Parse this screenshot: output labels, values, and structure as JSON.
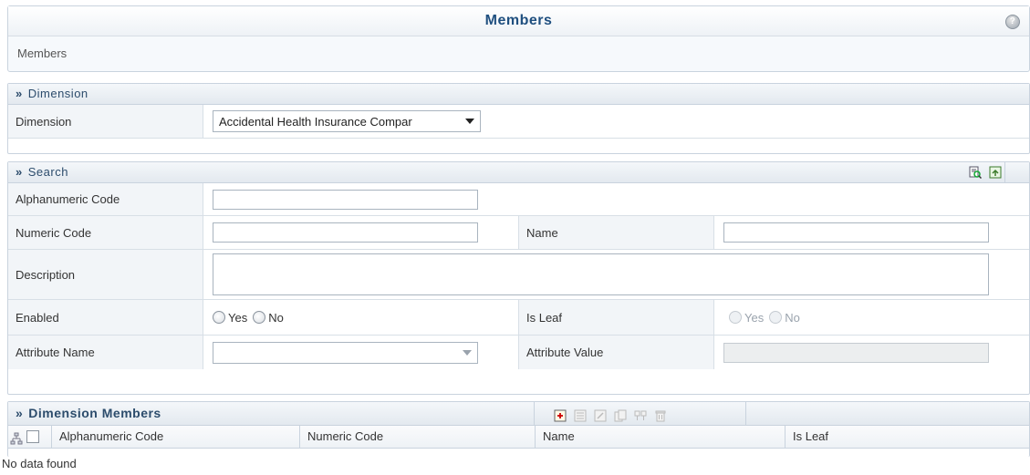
{
  "page": {
    "title": "Members",
    "breadcrumb": "Members",
    "help_icon": "help-icon"
  },
  "dimension_section": {
    "header": "Dimension",
    "label": "Dimension",
    "selected": "Accidental Health Insurance Compar"
  },
  "search_section": {
    "header": "Search",
    "toolbar_icons": [
      "search-icon",
      "reset-icon"
    ],
    "fields": {
      "alphanumeric_code": {
        "label": "Alphanumeric Code",
        "value": ""
      },
      "numeric_code": {
        "label": "Numeric Code",
        "value": ""
      },
      "name": {
        "label": "Name",
        "value": ""
      },
      "description": {
        "label": "Description",
        "value": ""
      },
      "enabled": {
        "label": "Enabled",
        "yes": "Yes",
        "no": "No"
      },
      "is_leaf": {
        "label": "Is Leaf",
        "yes": "Yes",
        "no": "No"
      },
      "attribute_name": {
        "label": "Attribute Name",
        "value": ""
      },
      "attribute_value": {
        "label": "Attribute Value",
        "value": ""
      }
    }
  },
  "members_section": {
    "header": "Dimension Members",
    "toolbar_icons": [
      "add-icon",
      "view-icon",
      "edit-icon",
      "copy-icon",
      "properties-icon",
      "delete-icon"
    ],
    "columns": [
      "Alphanumeric Code",
      "Numeric Code",
      "Name",
      "Is Leaf"
    ],
    "empty_text": "No data found"
  }
}
